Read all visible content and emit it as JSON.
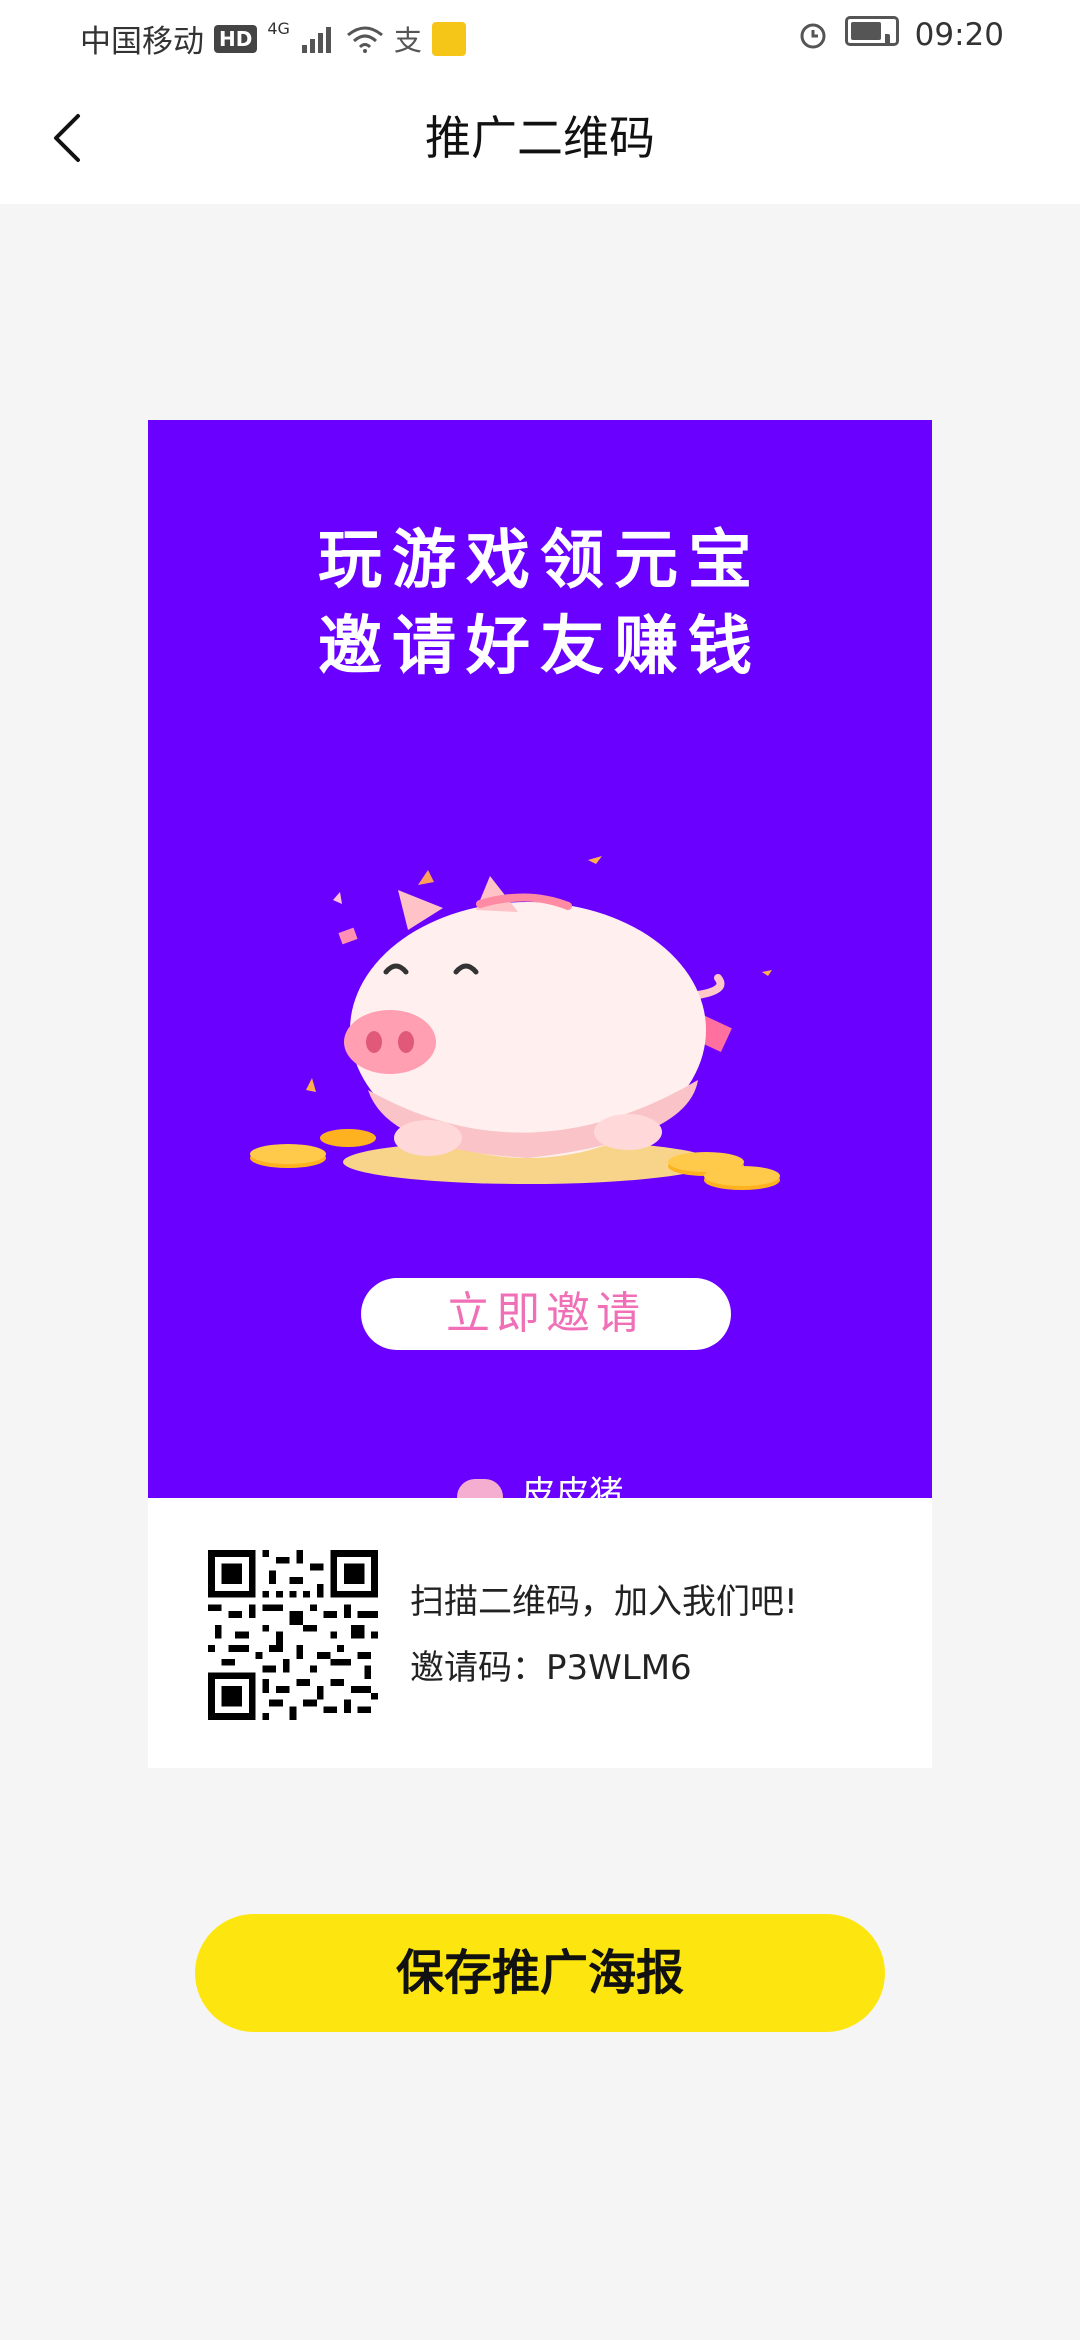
{
  "status_bar": {
    "carrier": "中国移动",
    "hd": "HD",
    "network": "4G",
    "time": "09:20"
  },
  "header": {
    "title": "推广二维码",
    "back_icon": "chevron-left-icon"
  },
  "poster": {
    "headline_line1": "玩游戏领元宝",
    "headline_line2": "邀请好友赚钱",
    "invite_button_label": "立即邀请",
    "brand_name": "皮皮猪",
    "background_color": "#6a00ff",
    "button_text_color": "#f06fb6"
  },
  "qr_card": {
    "scan_text": "扫描二维码，加入我们吧!",
    "invite_code_text": "邀请码：P3WLM6"
  },
  "save_button": {
    "label": "保存推广海报",
    "color": "#fde60f"
  }
}
